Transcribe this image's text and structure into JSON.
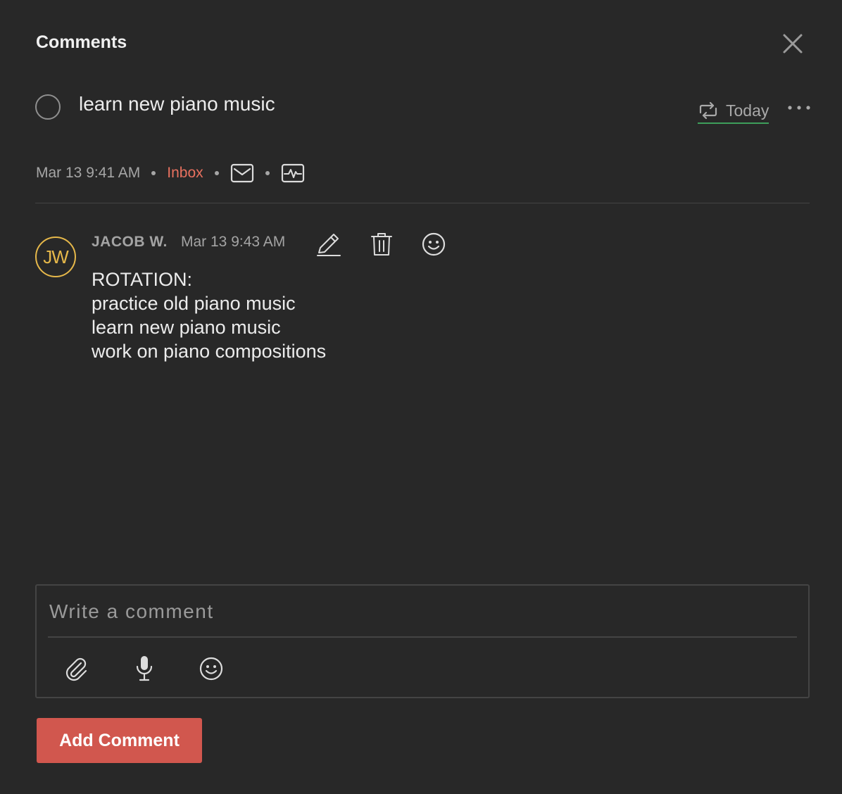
{
  "header": {
    "title": "Comments",
    "close_icon": "close-icon"
  },
  "task": {
    "title": "learn new piano music",
    "completed": false,
    "due_label": "Today",
    "due_icon": "recurring-icon",
    "more_icon": "more-horizontal-icon"
  },
  "meta": {
    "created": "Mar 13 9:41 AM",
    "project": "Inbox",
    "icons": [
      "mail-icon",
      "activity-icon"
    ]
  },
  "comments": [
    {
      "avatar_initials": "JW",
      "author": "JACOB W.",
      "time": "Mar 13 9:43 AM",
      "actions": [
        "edit-icon",
        "trash-icon",
        "emoji-icon"
      ],
      "body": "ROTATION:\npractice old piano music\nlearn new piano music\nwork on piano compositions"
    }
  ],
  "composer": {
    "placeholder": "Write a comment",
    "value": "",
    "tools": [
      "paperclip-icon",
      "microphone-icon",
      "emoji-icon"
    ]
  },
  "submit": {
    "label": "Add Comment"
  },
  "colors": {
    "background": "#282828",
    "accent": "#d1574e",
    "inbox": "#e8715f",
    "due_underline": "#3e9e5b",
    "avatar": "#e6b84a"
  }
}
